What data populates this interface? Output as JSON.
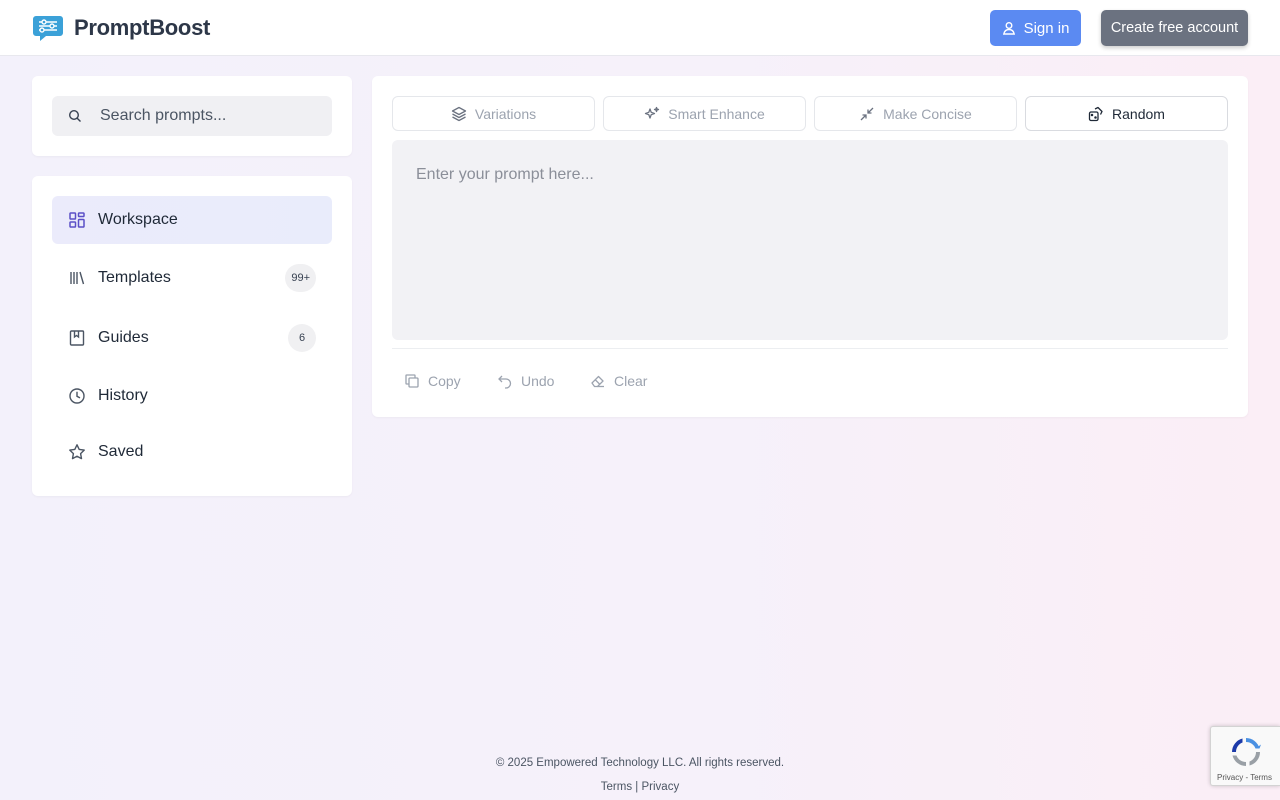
{
  "header": {
    "brand": "PromptBoost",
    "sign_in_label": "Sign in",
    "create_account_label": "Create free account"
  },
  "search": {
    "placeholder": "Search prompts..."
  },
  "nav": {
    "items": [
      {
        "label": "Workspace",
        "icon": "grid-icon",
        "active": true
      },
      {
        "label": "Templates",
        "icon": "library-icon",
        "badge": "99+"
      },
      {
        "label": "Guides",
        "icon": "book-icon",
        "badge": "6"
      },
      {
        "label": "History",
        "icon": "clock-icon"
      },
      {
        "label": "Saved",
        "icon": "star-icon"
      }
    ]
  },
  "tools": [
    {
      "label": "Variations",
      "icon": "layers-icon"
    },
    {
      "label": "Smart Enhance",
      "icon": "sparkles-icon"
    },
    {
      "label": "Make Concise",
      "icon": "minimize-icon"
    },
    {
      "label": "Random",
      "icon": "dice-icon"
    }
  ],
  "editor": {
    "placeholder": "Enter your prompt here..."
  },
  "actions": {
    "copy_label": "Copy",
    "undo_label": "Undo",
    "clear_label": "Clear"
  },
  "footer": {
    "copyright": "© 2025 Empowered Technology LLC. All rights reserved.",
    "terms_label": "Terms",
    "separator": "|",
    "privacy_label": "Privacy"
  },
  "recaptcha": {
    "links": "Privacy - Terms"
  },
  "colors": {
    "primary": "#5b8af2",
    "secondary_button": "#6b7280",
    "brand_icon": "#3ba1d8",
    "nav_icon_active": "#5b4fc7"
  }
}
